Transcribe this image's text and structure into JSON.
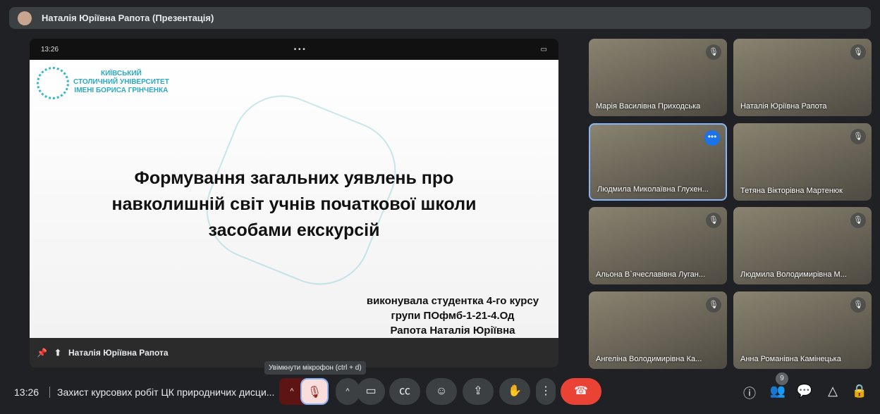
{
  "header": {
    "title": "Наталія Юріївна Рапота (Презентація)"
  },
  "presentation": {
    "status_time": "13:26",
    "logo_lines": [
      "КИЇВСЬКИЙ",
      "СТОЛИЧНИЙ УНІВЕРСИТЕТ",
      "ІМЕНІ БОРИСА ГРІНЧЕНКА"
    ],
    "title_lines": [
      "Формування загальних уявлень про",
      "навколишній світ учнів початкової школи",
      "засобами екскурсій"
    ],
    "author_lines": [
      "виконувала студентка 4-го курсу",
      "групи ПОфмб-1-21-4.Од",
      "Рапота Наталія Юріївна"
    ],
    "presenter": "Наталія Юріївна Рапота"
  },
  "participants": [
    {
      "name": "Марія Василівна Приходська"
    },
    {
      "name": "Наталія Юріївна Рапота"
    },
    {
      "name": "Людмила Миколаївна Глухен..."
    },
    {
      "name": "Тетяна Вікторівна Мартенюк"
    },
    {
      "name": "Альона В`ячеславівна Луган..."
    },
    {
      "name": "Людмила Володимирівна М..."
    },
    {
      "name": "Ангеліна Володимирівна Ка..."
    },
    {
      "name": "Анна Романівна Камінецька"
    }
  ],
  "tooltip": "Увімкнути мікрофон (ctrl + d)",
  "footer": {
    "time": "13:26",
    "meeting": "Захист курсових робіт ЦК природничих дисци...",
    "people_count": "9"
  }
}
